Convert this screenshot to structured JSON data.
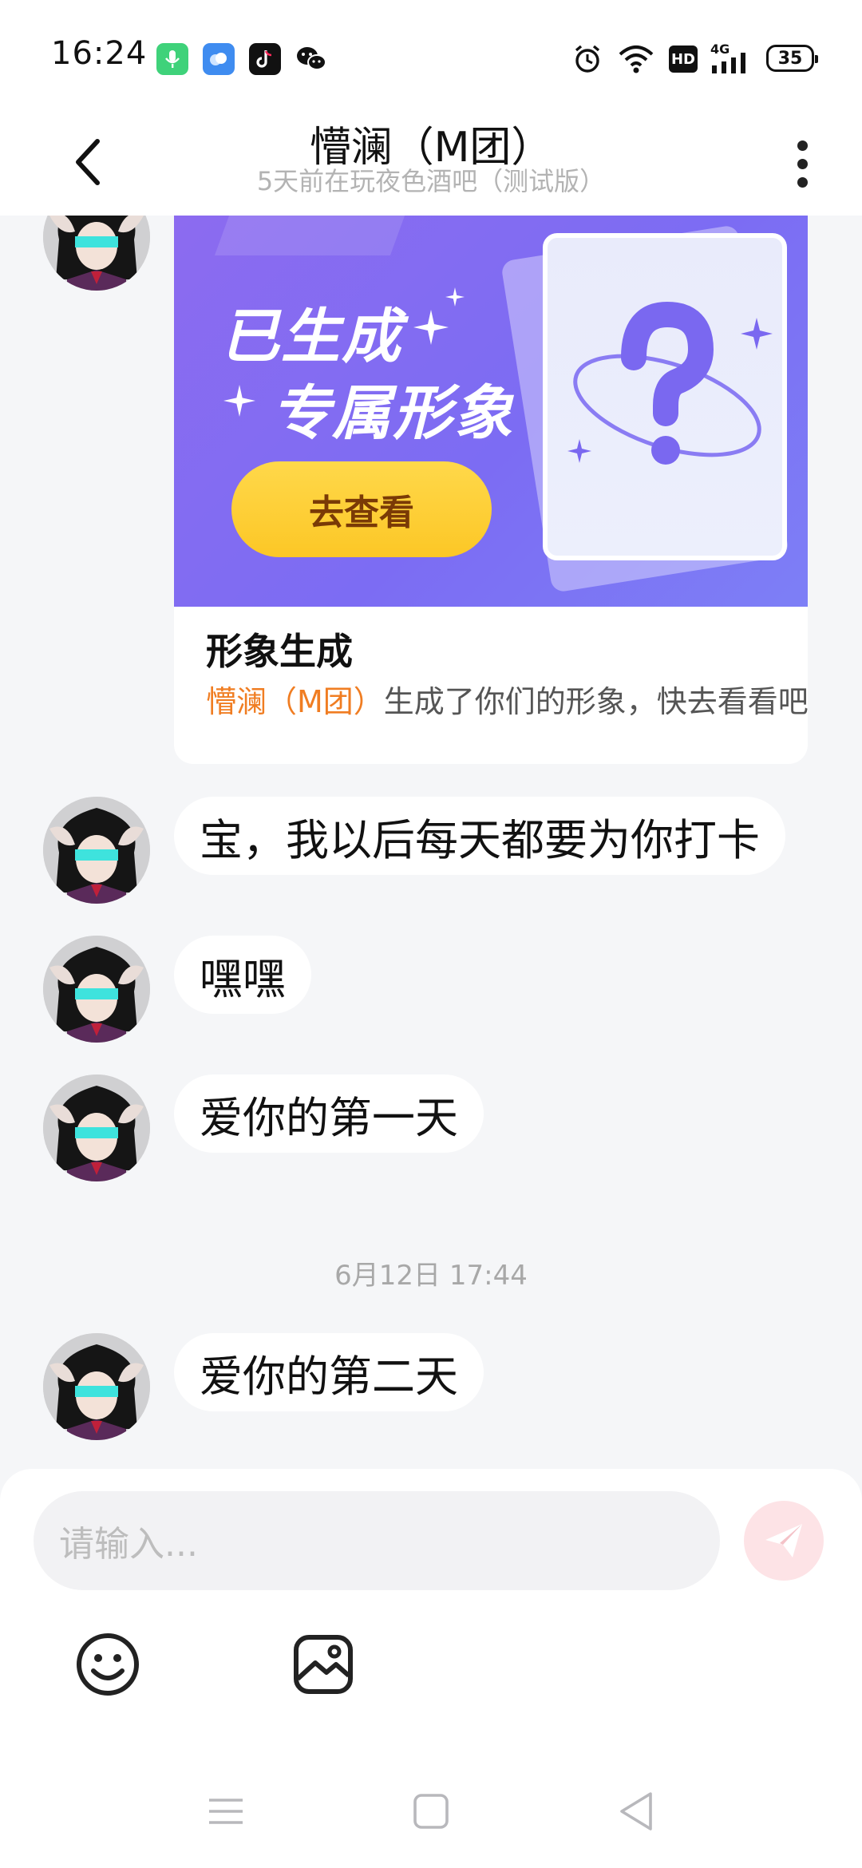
{
  "status_bar": {
    "time": "16:24",
    "app_icons": [
      "voice-memo-icon",
      "cloud-app-icon",
      "tiktok-icon",
      "wechat-icon"
    ],
    "hd_label": "HD",
    "network_label": "4G",
    "battery_level": "35"
  },
  "header": {
    "title": "懵澜（M团）",
    "subtitle": "5天前在玩夜色酒吧（测试版）"
  },
  "card": {
    "banner_line1": "已生成",
    "banner_line2": "专属形象",
    "button_label": "去查看",
    "title": "形象生成",
    "desc_name": "懵澜（M团）",
    "desc_text": "生成了你们的形象，快去看看吧"
  },
  "messages": [
    {
      "text": "宝，我以后每天都要为你打卡"
    },
    {
      "text": "嘿嘿"
    },
    {
      "text": "爱你的第一天"
    },
    {
      "text": "爱你的第二天"
    }
  ],
  "timestamp": "6月12日 17:44",
  "input": {
    "placeholder": "请输入..."
  },
  "colors": {
    "accent_orange": "#f07d22",
    "banner_purple": "#7c6cf3",
    "button_yellow": "#fcc726",
    "send_pink": "#fde3e6",
    "background": "#f5f6f8"
  }
}
